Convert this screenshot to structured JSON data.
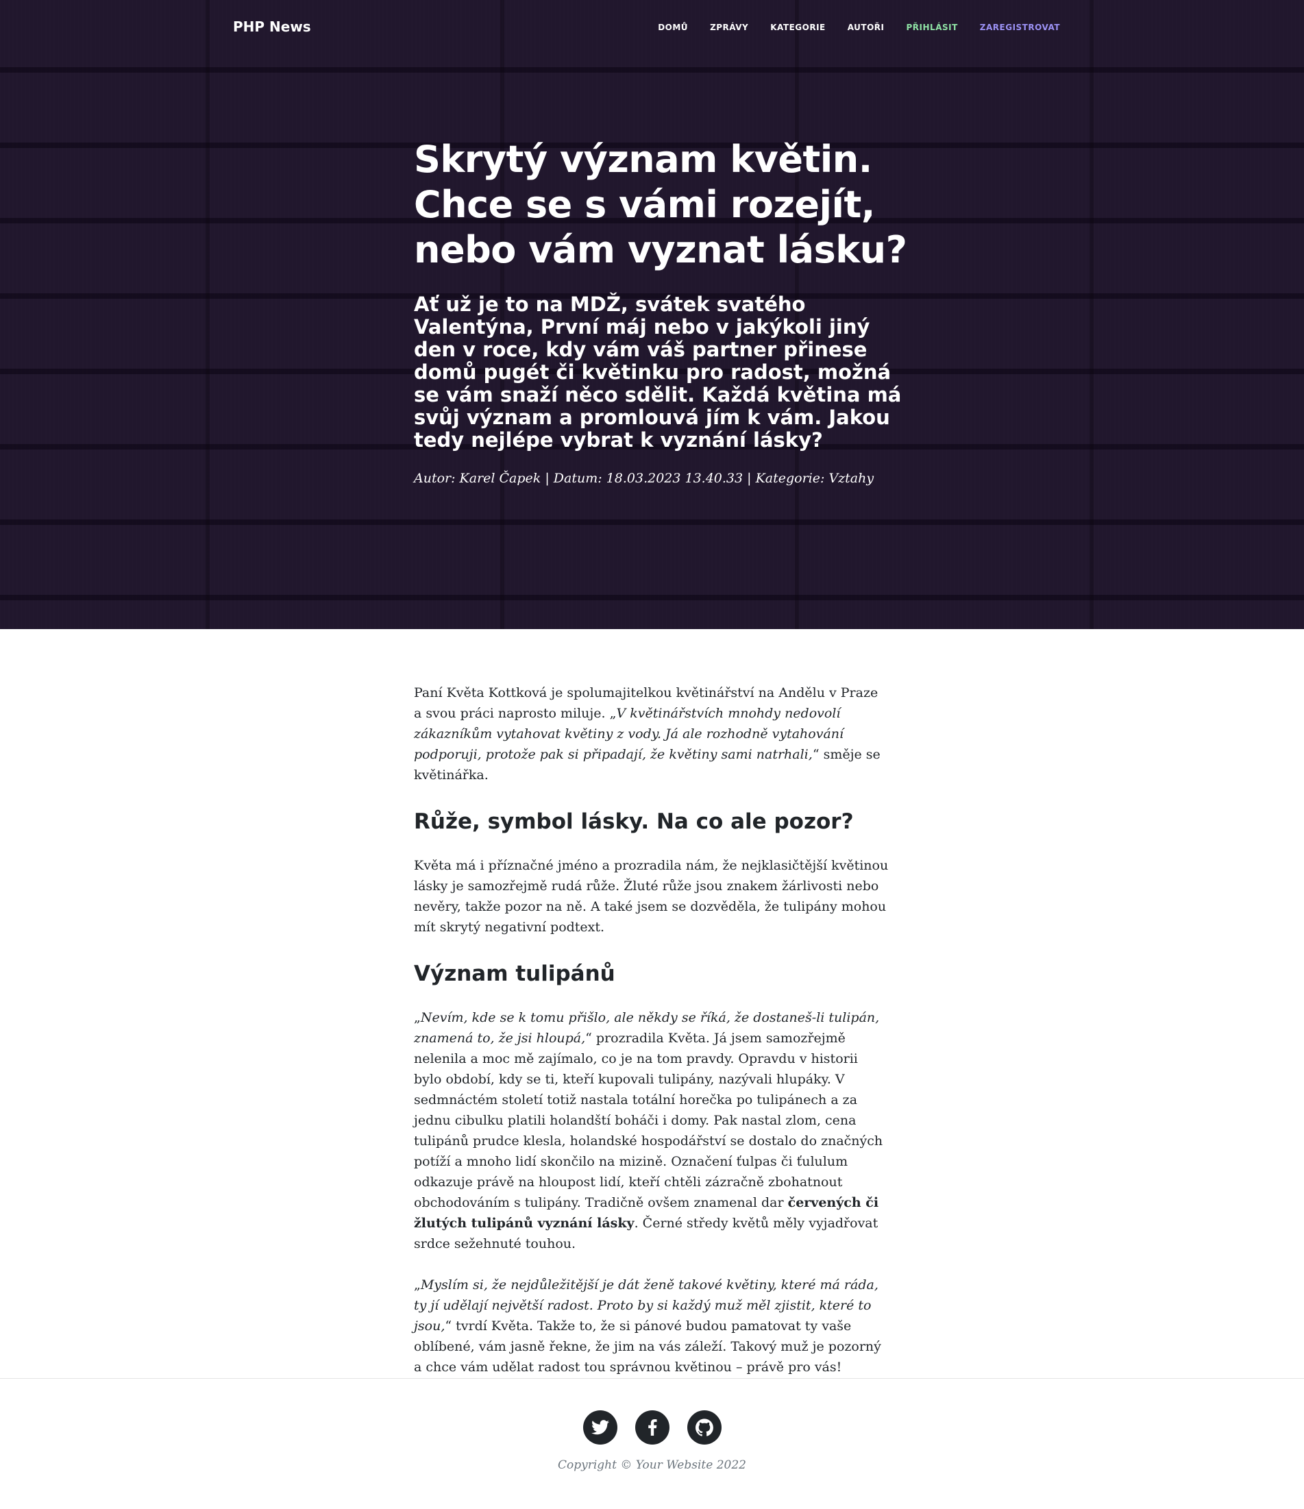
{
  "nav": {
    "brand": "PHP News",
    "links": [
      "DOMŮ",
      "ZPRÁVY",
      "KATEGORIE",
      "AUTOŘI"
    ],
    "login": "PŘIHLÁSIT",
    "register": "ZAREGISTROVAT"
  },
  "header": {
    "title": "Skrytý význam květin. Chce se s vámi rozejít, nebo vám vyznat lásku?",
    "subtitle": "Ať už je to na MDŽ, svátek svatého Valentýna, První máj nebo v jakýkoli jiný den v roce, kdy vám váš partner přinese domů pugét či květinku pro radost, možná se vám snaží něco sdělit. Každá květina má svůj význam a promlouvá jím k vám. Jakou tedy nejlépe vybrat k vyznání lásky?",
    "meta": "Autor: Karel Čapek | Datum: 18.03.2023 13.40.33 | Kategorie: Vztahy"
  },
  "article": {
    "p1_a": "Paní Květa Kottková je spolumajitelkou květinářství na Andělu v Praze a svou práci naprosto miluje. „",
    "p1_quote": "V květinářstvích mnohdy nedovolí zákazníkům vytahovat květiny z vody. Já ale rozhodně vytahování podporuji, protože pak si připadají, že květiny sami natrhali,",
    "p1_b": "“ směje se květinářka.",
    "h_roses": "Růže, symbol lásky. Na co ale pozor?",
    "p2": "Květa má i příznačné jméno a prozradila nám, že nejklasičtější květinou lásky je samozřejmě rudá růže. Žluté růže jsou znakem žárlivosti nebo nevěry, takže pozor na ně. A také jsem se dozvěděla, že tulipány mohou mít skrytý negativní podtext.",
    "h_tulips": "Význam tulipánů",
    "p3_a": "„",
    "p3_quote": "Nevím, kde se k tomu přišlo, ale někdy se říká, že dostaneš-li tulipán, znamená to, že jsi hloupá,",
    "p3_b": "“ prozradila Květa. Já jsem samozřejmě nelenila a moc mě zajímalo, co je na tom pravdy. Opravdu v historii bylo období, kdy se ti, kteří kupovali tulipány, nazývali hlupáky. V sedmnáctém století totiž nastala totální horečka po tulipánech a za jednu cibulku platili holandští boháči i domy. Pak nastal zlom, cena tulipánů prudce klesla, holandské hospodářství se dostalo do značných potíží a mnoho lidí skončilo na mizině. Označení ťulpas či ťululum odkazuje právě na hloupost lidí, kteří chtěli zázračně zbohatnout obchodováním s tulipány. Tradičně ovšem znamenal dar ",
    "p3_bold": "červených či žlutých tulipánů vyznání lásky",
    "p3_c": ". Černé středy květů měly vyjadřovat srdce sežehnuté touhou.",
    "p4_a": "„",
    "p4_quote": "Myslím si, že nejdůležitější je dát ženě takové květiny, které má ráda, ty jí udělají největší radost. Proto by si každý muž měl zjistit, které to jsou,",
    "p4_b": "“ tvrdí Květa. Takže to, že si pánové budou pamatovat ty vaše oblíbené, vám jasně řekne, že jim na vás záleží. Takový muž je pozorný a chce vám udělat radost tou správnou květinou – právě pro vás!"
  },
  "footer": {
    "social_icons": [
      "twitter-icon",
      "facebook-icon",
      "github-icon"
    ],
    "copyright": "Copyright © Your Website 2022"
  },
  "colors": {
    "hero_bg": "#31243f",
    "login": "#8fe3a5",
    "register": "#9c92f5",
    "text": "#212529",
    "muted": "#6c757d"
  }
}
